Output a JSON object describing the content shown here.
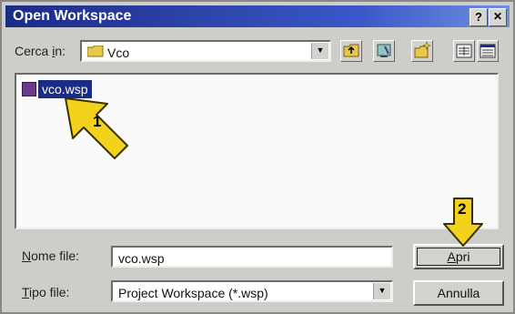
{
  "window": {
    "title": "Open Workspace",
    "help_icon": "?",
    "close_icon": "✕"
  },
  "look_in": {
    "label_prefix": "Cerca ",
    "label_accel": "i",
    "label_suffix": "n:",
    "folder": "Vco"
  },
  "toolbar_icons": [
    "up-folder-icon",
    "desktop-icon",
    "new-folder-icon",
    "list-view-icon",
    "details-view-icon"
  ],
  "files": [
    {
      "name": "vco.wsp",
      "selected": true
    }
  ],
  "filename": {
    "label_accel": "N",
    "label_rest": "ome file:",
    "value": "vco.wsp"
  },
  "filetype": {
    "label_accel": "T",
    "label_rest": "ipo file:",
    "value": "Project Workspace (*.wsp)"
  },
  "buttons": {
    "open_accel": "A",
    "open_rest": "pri",
    "cancel": "Annulla"
  },
  "callouts": {
    "one": "1",
    "two": "2",
    "color": "#f3d21b"
  }
}
